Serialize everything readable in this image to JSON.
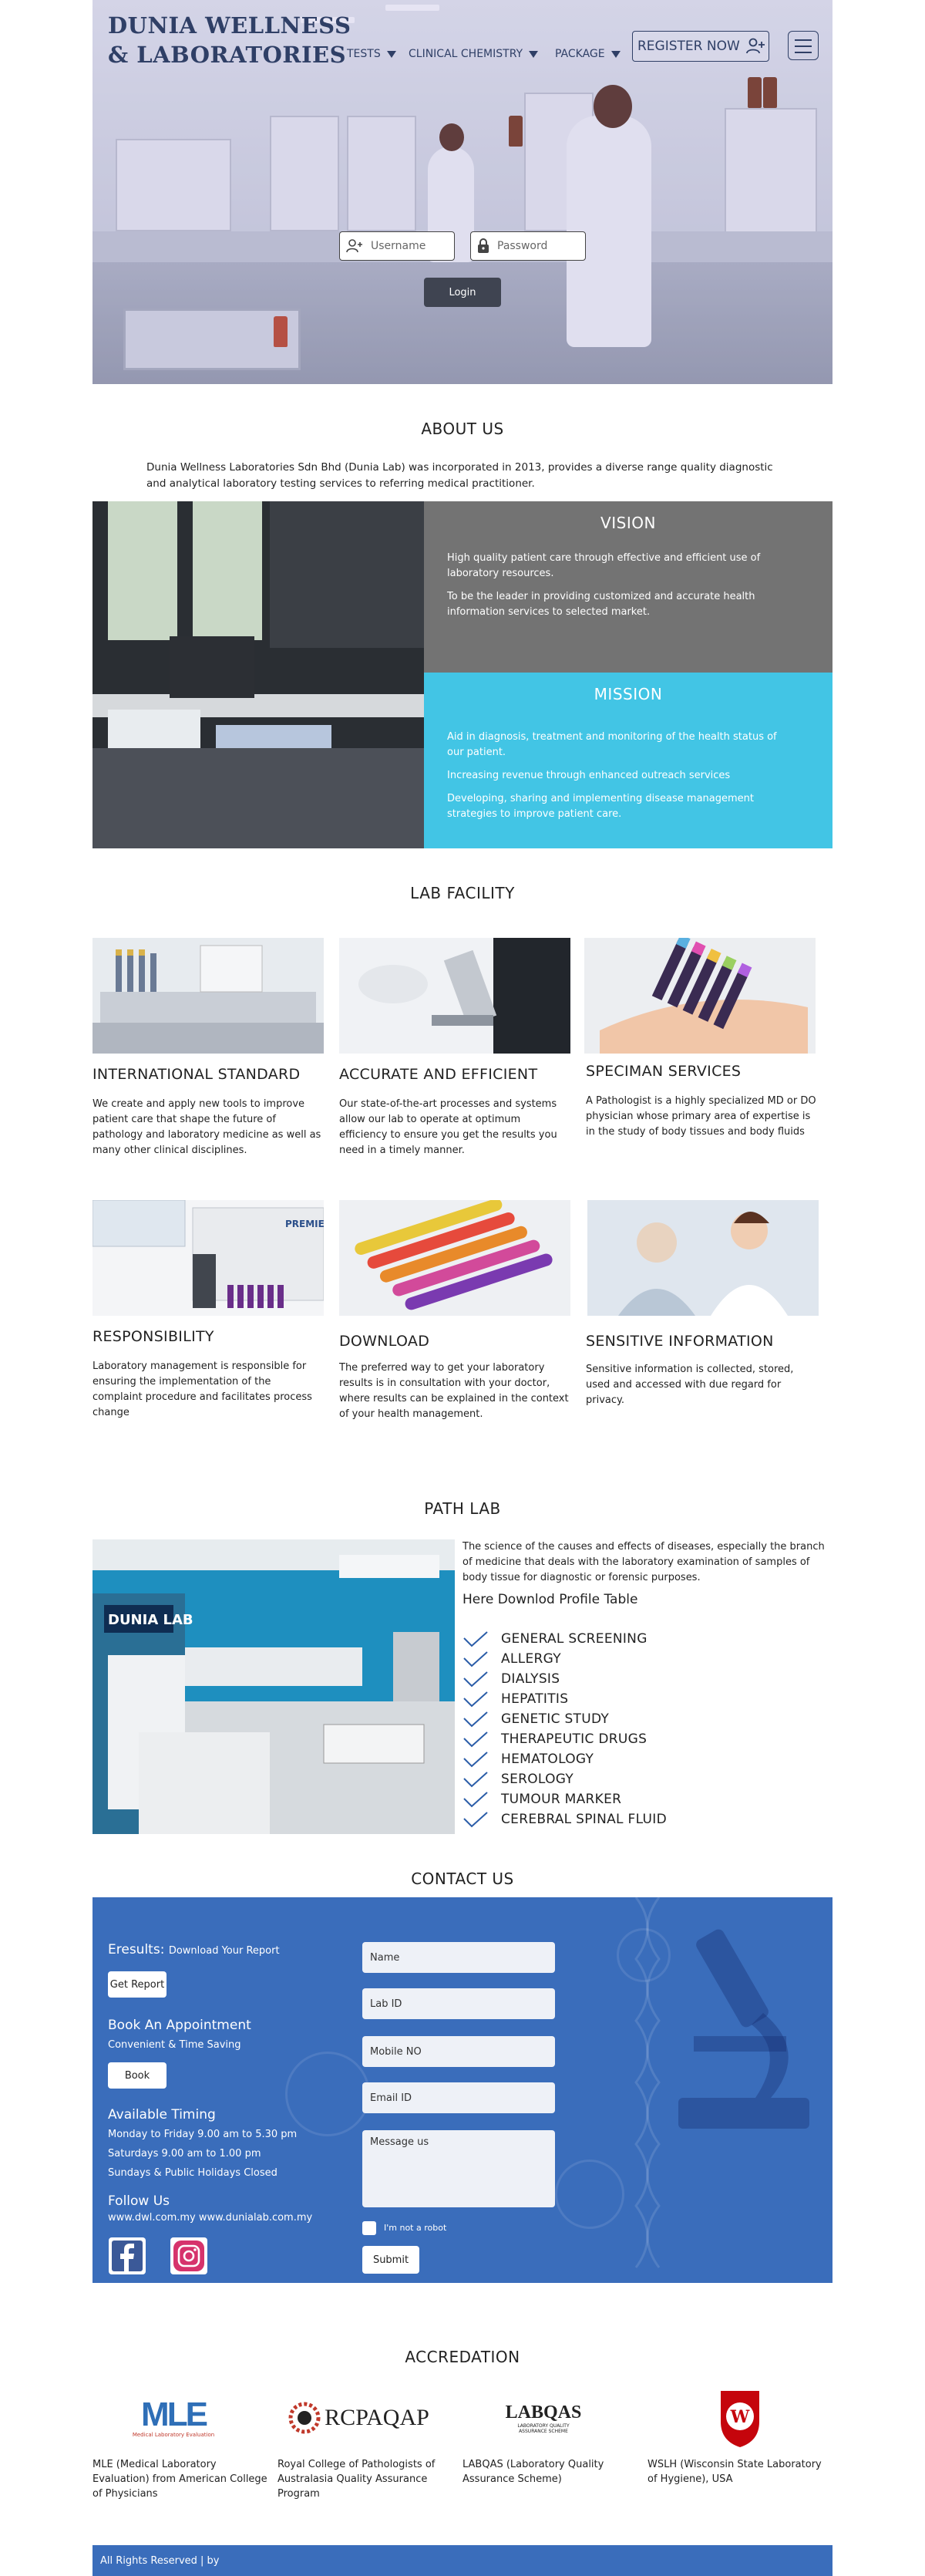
{
  "brand": {
    "line1": "DUNIA WELLNESS",
    "line2": "& LABORATORIES"
  },
  "nav": {
    "items": [
      {
        "label": "TESTS"
      },
      {
        "label": "CLINICAL CHEMISTRY"
      },
      {
        "label": "PACKAGE"
      }
    ],
    "register_label": "REGISTER NOW"
  },
  "login": {
    "username_placeholder": "Username",
    "password_placeholder": "Password",
    "button_label": "Login"
  },
  "about": {
    "title": "ABOUT US",
    "text": "Dunia Wellness Laboratories Sdn Bhd (Dunia Lab) was incorporated in 2013, provides a diverse range quality diagnostic and analytical laboratory testing services to referring medical practitioner."
  },
  "vision": {
    "title": "VISION",
    "items": [
      "High quality patient care through effective and efficient use of laboratory resources.",
      "To be the leader in providing customized and accurate health information services to selected market."
    ]
  },
  "mission": {
    "title": "MISSION",
    "items": [
      "Aid in diagnosis, treatment and monitoring of the health status of our patient.",
      "Increasing revenue through enhanced outreach services",
      "Developing, sharing and implementing disease management strategies to improve patient care."
    ]
  },
  "facility": {
    "title": "LAB FACILITY",
    "cards": [
      {
        "title": "INTERNATIONAL STANDARD",
        "text": "We create and apply new tools to improve patient care that shape the future of pathology and laboratory medicine as well as many other clinical disciplines."
      },
      {
        "title": "ACCURATE AND EFFICIENT",
        "text": "Our state-of-the-art processes and systems allow our lab to operate at optimum efficiency to ensure you get the results you need in a timely manner."
      },
      {
        "title": "SPECIMAN  SERVICES",
        "text": "A Pathologist is a highly specialized MD or DO physician whose primary area of expertise is in the study of body tissues and body fluids"
      },
      {
        "title": "RESPONSIBILITY",
        "text": "Laboratory management is responsible for ensuring the implementation of the complaint procedure and facilitates process change"
      },
      {
        "title": "DOWNLOAD",
        "text": "The preferred way to get your laboratory results is in consultation with your doctor, where results can be explained in the context of your health management."
      },
      {
        "title": "SENSITIVE INFORMATION",
        "text": "Sensitive information is collected, stored, used and accessed with due regard for privacy."
      }
    ]
  },
  "pathlab": {
    "title": "PATH LAB",
    "photo_sign": "DUNIA LAB",
    "text": "The science of the causes and effects of diseases, especially the branch of medicine that deals with the laboratory examination of samples of body tissue for diagnostic or forensic purposes.",
    "subtitle": "Here Downlod Profile Table",
    "items": [
      "GENERAL SCREENING",
      "ALLERGY",
      "DIALYSIS",
      "HEPATITIS",
      "GENETIC STUDY",
      "THERAPEUTIC DRUGS",
      "HEMATOLOGY",
      "SEROLOGY",
      "TUMOUR MARKER",
      "CEREBRAL SPINAL FLUID"
    ]
  },
  "contact": {
    "title": "CONTACT US",
    "eresults_label": "Eresults:",
    "eresults_sub": "Download Your Report",
    "get_report": "Get Report",
    "appointment_title": "Book An Appointment",
    "appointment_sub": "Convenient & Time Saving",
    "book": "Book",
    "timing_title": "Available Timing",
    "timing": [
      "Monday to Friday 9.00 am to 5.30 pm",
      "Saturdays 9.00 am to 1.00 pm",
      "Sundays & Public Holidays Closed"
    ],
    "follow_title": "Follow Us",
    "links": "www.dwl.com.my  www.dunialab.com.my",
    "form": {
      "name": "Name",
      "lab_id": "Lab ID",
      "mobile": "Mobile NO",
      "email": "Email ID",
      "message": "Message us",
      "captcha": "I'm not a robot",
      "submit": "Submit"
    }
  },
  "accreditation": {
    "title": "ACCREDATION",
    "items": [
      {
        "logo": "MLE",
        "logo_sub": "Medical Laboratory Evaluation",
        "text": "MLE (Medical Laboratory Evaluation) from American College of Physicians"
      },
      {
        "logo": "RCPAQAP",
        "text": "Royal College of Pathologists of Australasia Quality Assurance Program"
      },
      {
        "logo": "LABQAS",
        "logo_sub": "LABORATORY QUALITY ASSURANCE SCHEME",
        "text": "LABQAS (Laboratory Quality Assurance Scheme)"
      },
      {
        "logo": "W",
        "text": "WSLH (Wisconsin State Laboratory of Hygiene), USA"
      }
    ]
  },
  "footer": {
    "text": "All Rights Reserved | by"
  },
  "colors": {
    "blue": "#3a6dbb",
    "cyan": "#42c5e5",
    "gray": "#737373",
    "navy": "#2f3f66"
  }
}
